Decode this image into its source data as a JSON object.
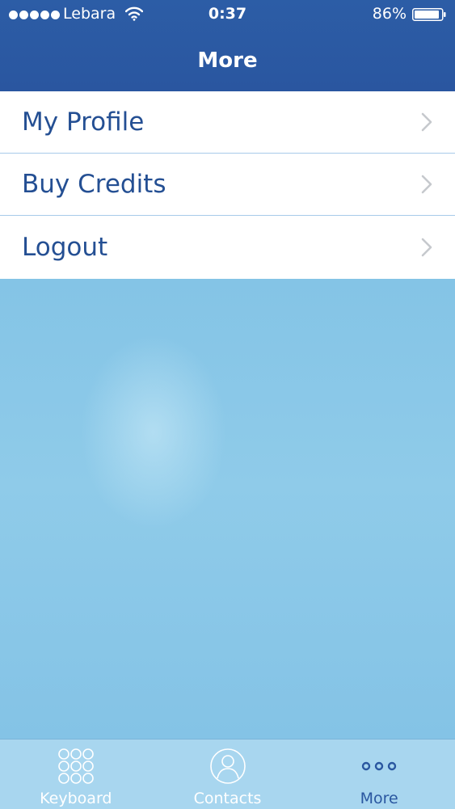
{
  "status_bar": {
    "carrier": "Lebara",
    "time": "0:37",
    "battery": "86%",
    "icons": [
      "signal-dots-icon",
      "wifi-icon",
      "battery-icon"
    ]
  },
  "nav": {
    "title": "More"
  },
  "menu": {
    "items": [
      {
        "label": "My Profile"
      },
      {
        "label": "Buy Credits"
      },
      {
        "label": "Logout"
      }
    ]
  },
  "tab_bar": {
    "tabs": [
      {
        "label": "Keyboard",
        "icon": "keypad-icon"
      },
      {
        "label": "Contacts",
        "icon": "contacts-icon"
      },
      {
        "label": "More",
        "icon": "more-dots-icon",
        "selected": true
      }
    ]
  },
  "colors": {
    "header": "#2c5da6",
    "menu_text": "#244f93",
    "content_bg": "#8cc6e6",
    "tab_bar": "#a8d6ef",
    "active_tab": "#2a57a0"
  }
}
